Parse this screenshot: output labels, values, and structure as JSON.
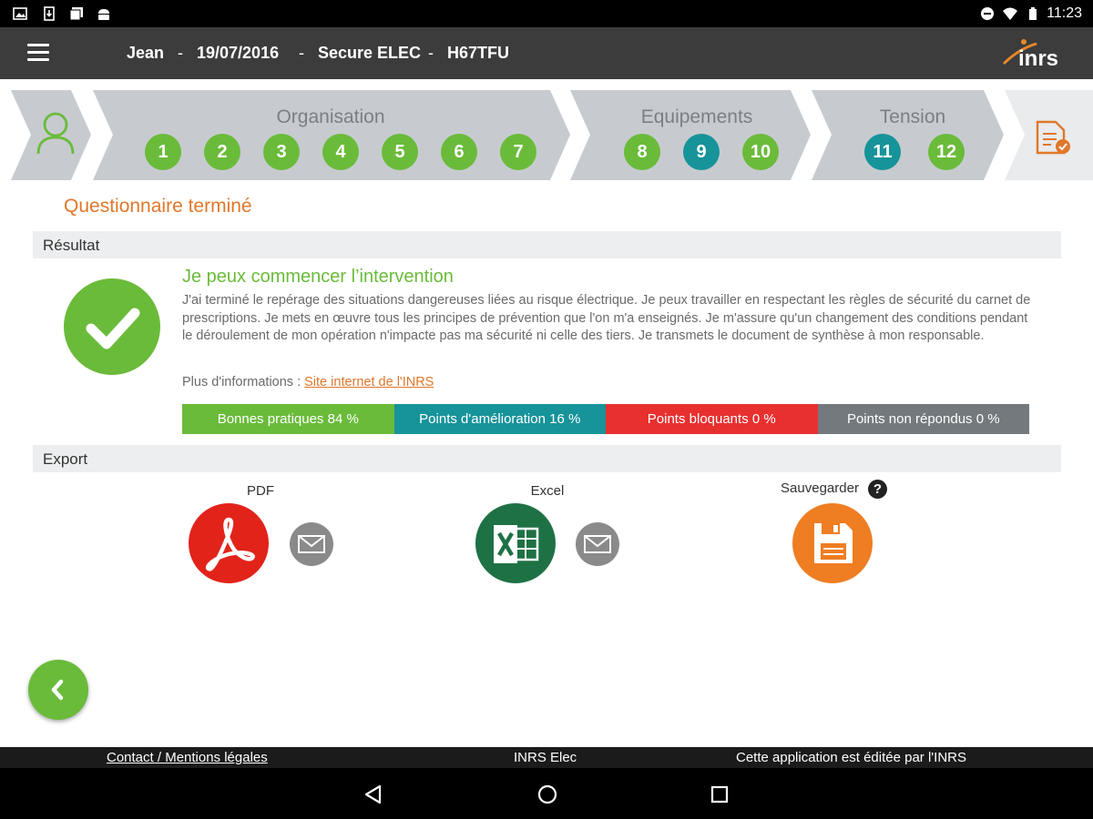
{
  "status_bar": {
    "time": "11:23",
    "icons": [
      "image-icon",
      "sim-download-icon",
      "photos-icon",
      "android-icon",
      "do-not-disturb-icon",
      "wifi-icon",
      "battery-icon"
    ]
  },
  "header": {
    "user": "Jean",
    "date": "19/07/2016",
    "app": "Secure ELEC",
    "code": "H67TFU",
    "separator": "-",
    "logo_text": "inrs",
    "icons": [
      "menu-icon"
    ]
  },
  "stepper": {
    "user_icon": "user-icon",
    "groups": [
      {
        "label": "Organisation",
        "steps": [
          {
            "n": "1",
            "state": "green"
          },
          {
            "n": "2",
            "state": "green"
          },
          {
            "n": "3",
            "state": "green"
          },
          {
            "n": "4",
            "state": "green"
          },
          {
            "n": "5",
            "state": "green"
          },
          {
            "n": "6",
            "state": "green"
          },
          {
            "n": "7",
            "state": "green"
          }
        ]
      },
      {
        "label": "Equipements",
        "steps": [
          {
            "n": "8",
            "state": "green"
          },
          {
            "n": "9",
            "state": "teal"
          },
          {
            "n": "10",
            "state": "green"
          }
        ]
      },
      {
        "label": "Tension",
        "steps": [
          {
            "n": "11",
            "state": "teal"
          },
          {
            "n": "12",
            "state": "green"
          }
        ]
      }
    ],
    "report_icon": "report-check-icon"
  },
  "questionnaire_title": "Questionnaire terminé",
  "result": {
    "section_label": "Résultat",
    "title": "Je peux commencer l’intervention",
    "text": "J'ai terminé le repérage des situations dangereuses liées au risque électrique. Je peux travailler en respectant les règles de sécurité du carnet de prescriptions. Je mets en œuvre tous les principes de prévention que l'on m'a enseignés. Je m'assure qu'un changement des conditions pendant le déroulement de mon opération n'impacte pas ma sécurité ni celle des tiers. Je transmets le document de synthèse à mon responsable.",
    "more_info_label": "Plus d'informations :",
    "more_info_link": "Site internet de l'INRS",
    "score_segments": [
      {
        "label": "Bonnes pratiques 84 %",
        "color": "#6abb3a"
      },
      {
        "label": "Points d'amélioration 16 %",
        "color": "#17939a"
      },
      {
        "label": "Points bloquants 0 %",
        "color": "#e8302f"
      },
      {
        "label": "Points non répondus 0 %",
        "color": "#74797d"
      }
    ]
  },
  "export": {
    "section_label": "Export",
    "pdf_label": "PDF",
    "excel_label": "Excel",
    "save_label": "Sauvegarder",
    "help_glyph": "?",
    "colors": {
      "pdf": "#e2231a",
      "excel": "#1e7145",
      "save": "#ef7d22",
      "mail": "#8a8a8a"
    }
  },
  "footer": {
    "contact": "Contact / Mentions légales",
    "app_name": "INRS Elec",
    "publisher": "Cette application est éditée par l'INRS"
  },
  "colors": {
    "accent_orange": "#e0772b",
    "green": "#6abb3a",
    "teal": "#17939a",
    "app_bar": "#3c3c3c"
  }
}
